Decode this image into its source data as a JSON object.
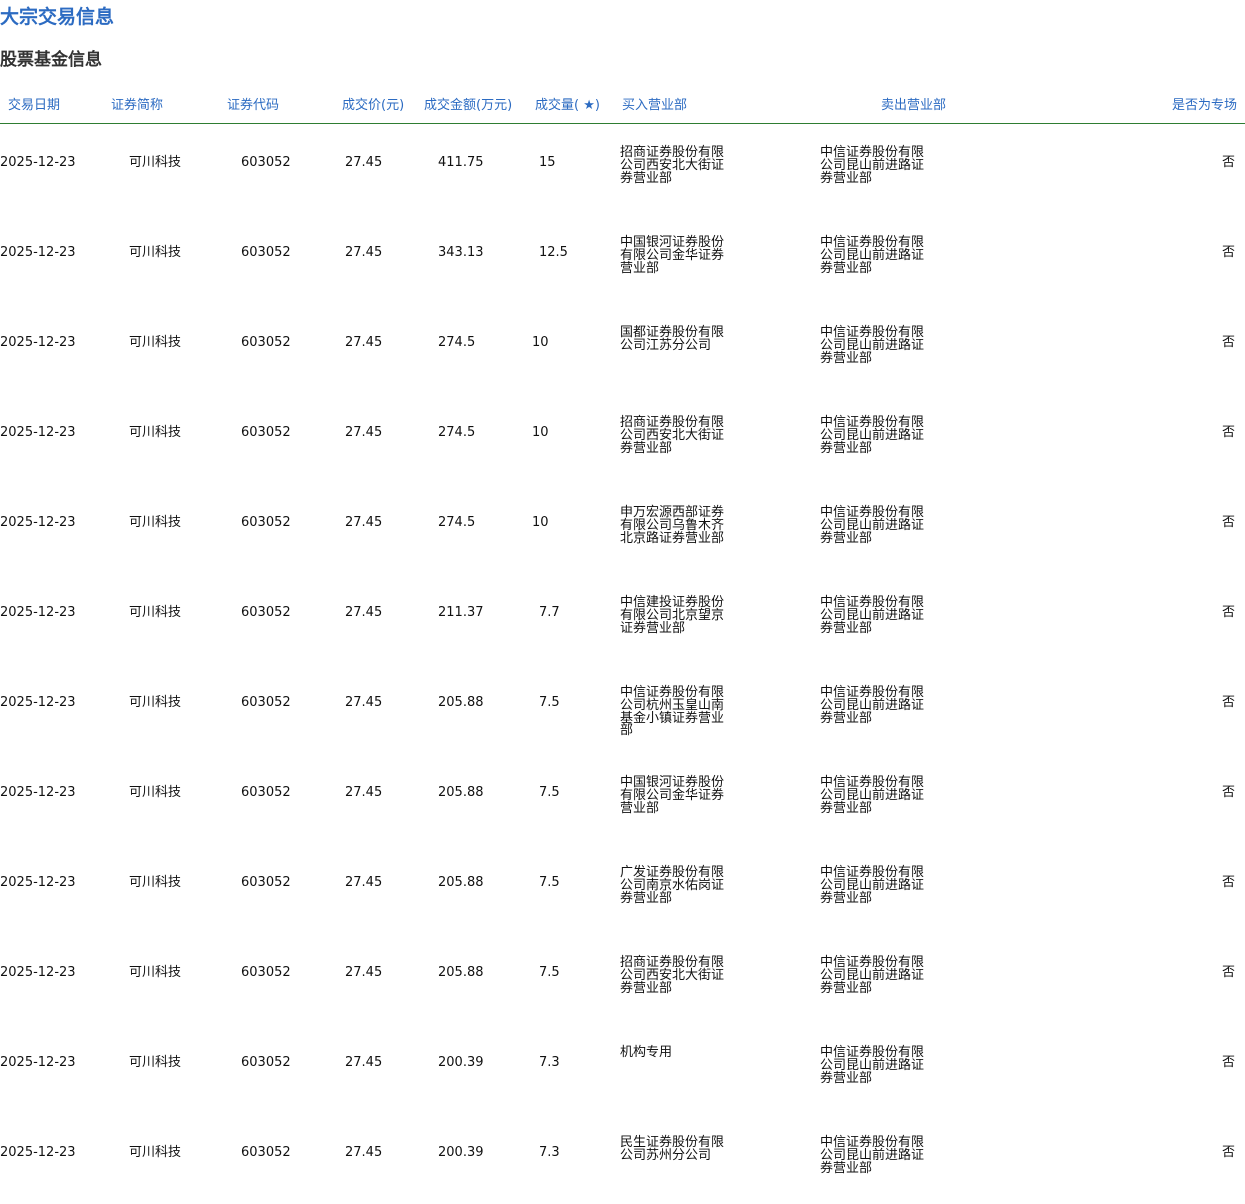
{
  "page_title": "大宗交易信息",
  "section_title": "股票基金信息",
  "columns": [
    "交易日期",
    "证券简称",
    "证券代码",
    "成交价(元)",
    "成交金额(万元)",
    "成交量( ★)",
    "买入营业部",
    "卖出营业部",
    "是否为专场"
  ],
  "rows": [
    {
      "date": "2025-12-23",
      "name": "可川科技",
      "code": "603052",
      "price": "27.45",
      "amount": "411.75",
      "volume": "15",
      "buyer": "招商证券股份有限公司西安北大街证券营业部",
      "seller": "中信证券股份有限公司昆山前进路证券营业部",
      "special": "否"
    },
    {
      "date": "2025-12-23",
      "name": "可川科技",
      "code": "603052",
      "price": "27.45",
      "amount": "343.13",
      "volume": "12.5",
      "buyer": "中国银河证券股份有限公司金华证券营业部",
      "seller": "中信证券股份有限公司昆山前进路证券营业部",
      "special": "否"
    },
    {
      "date": "2025-12-23",
      "name": "可川科技",
      "code": "603052",
      "price": "27.45",
      "amount": "274.5",
      "volume": "10",
      "buyer": "国都证券股份有限公司江苏分公司",
      "seller": "中信证券股份有限公司昆山前进路证券营业部",
      "special": "否"
    },
    {
      "date": "2025-12-23",
      "name": "可川科技",
      "code": "603052",
      "price": "27.45",
      "amount": "274.5",
      "volume": "10",
      "buyer": "招商证券股份有限公司西安北大街证券营业部",
      "seller": "中信证券股份有限公司昆山前进路证券营业部",
      "special": "否"
    },
    {
      "date": "2025-12-23",
      "name": "可川科技",
      "code": "603052",
      "price": "27.45",
      "amount": "274.5",
      "volume": "10",
      "buyer": "申万宏源西部证券有限公司乌鲁木齐北京路证券营业部",
      "seller": "中信证券股份有限公司昆山前进路证券营业部",
      "special": "否"
    },
    {
      "date": "2025-12-23",
      "name": "可川科技",
      "code": "603052",
      "price": "27.45",
      "amount": "211.37",
      "volume": "7.7",
      "buyer": "中信建投证券股份有限公司北京望京证券营业部",
      "seller": "中信证券股份有限公司昆山前进路证券营业部",
      "special": "否"
    },
    {
      "date": "2025-12-23",
      "name": "可川科技",
      "code": "603052",
      "price": "27.45",
      "amount": "205.88",
      "volume": "7.5",
      "buyer": "中信证券股份有限公司杭州玉皇山南基金小镇证券营业部",
      "seller": "中信证券股份有限公司昆山前进路证券营业部",
      "special": "否"
    },
    {
      "date": "2025-12-23",
      "name": "可川科技",
      "code": "603052",
      "price": "27.45",
      "amount": "205.88",
      "volume": "7.5",
      "buyer": "中国银河证券股份有限公司金华证券营业部",
      "seller": "中信证券股份有限公司昆山前进路证券营业部",
      "special": "否"
    },
    {
      "date": "2025-12-23",
      "name": "可川科技",
      "code": "603052",
      "price": "27.45",
      "amount": "205.88",
      "volume": "7.5",
      "buyer": "广发证券股份有限公司南京水佑岗证券营业部",
      "seller": "中信证券股份有限公司昆山前进路证券营业部",
      "special": "否"
    },
    {
      "date": "2025-12-23",
      "name": "可川科技",
      "code": "603052",
      "price": "27.45",
      "amount": "205.88",
      "volume": "7.5",
      "buyer": "招商证券股份有限公司西安北大街证券营业部",
      "seller": "中信证券股份有限公司昆山前进路证券营业部",
      "special": "否"
    },
    {
      "date": "2025-12-23",
      "name": "可川科技",
      "code": "603052",
      "price": "27.45",
      "amount": "200.39",
      "volume": "7.3",
      "buyer": "机构专用",
      "seller": "中信证券股份有限公司昆山前进路证券营业部",
      "special": "否"
    },
    {
      "date": "2025-12-23",
      "name": "可川科技",
      "code": "603052",
      "price": "27.45",
      "amount": "200.39",
      "volume": "7.3",
      "buyer": "民生证券股份有限公司苏州分公司",
      "seller": "中信证券股份有限公司昆山前进路证券营业部",
      "special": "否"
    }
  ]
}
